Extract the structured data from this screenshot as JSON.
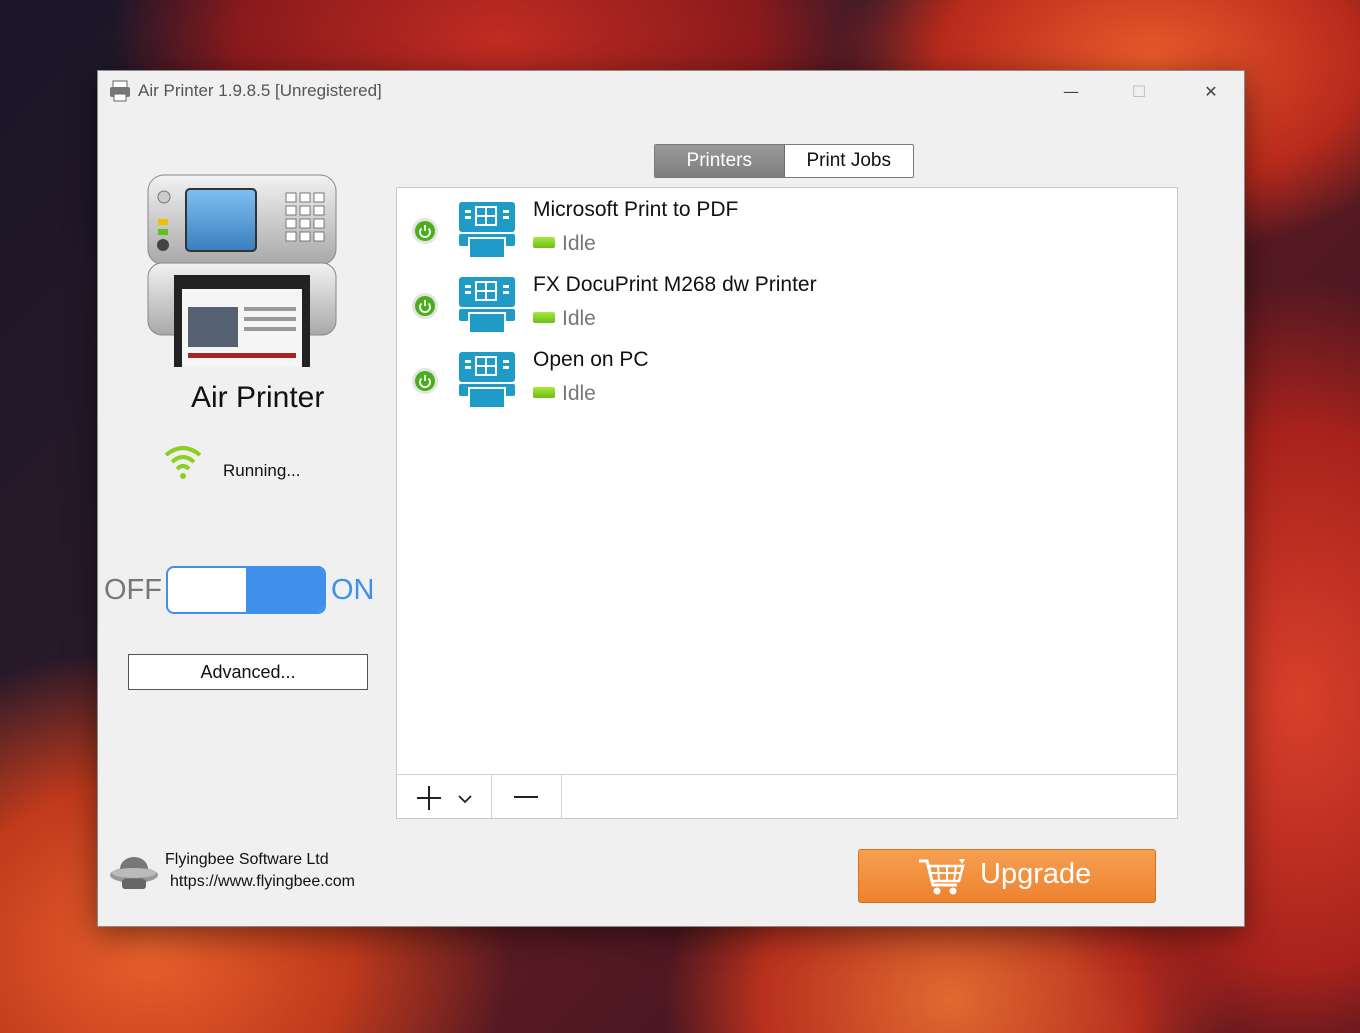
{
  "window": {
    "title": "Air Printer 1.9.8.5 [Unregistered]",
    "minimize_label": "—",
    "maximize_label": "☐",
    "close_label": "✕"
  },
  "sidebar": {
    "app_name": "Air Printer",
    "status": "Running...",
    "toggle": {
      "off_label": "OFF",
      "on_label": "ON",
      "state": "on"
    },
    "advanced_label": "Advanced..."
  },
  "tabs": [
    {
      "label": "Printers",
      "active": true
    },
    {
      "label": "Print Jobs",
      "active": false
    }
  ],
  "printers": [
    {
      "name": "Microsoft Print to PDF",
      "state": "Idle"
    },
    {
      "name": "FX DocuPrint M268 dw Printer",
      "state": "Idle"
    },
    {
      "name": "Open on PC",
      "state": "Idle"
    }
  ],
  "footer": {
    "company": "Flyingbee Software Ltd",
    "url": "https://www.flyingbee.com",
    "upgrade_label": "Upgrade"
  },
  "colors": {
    "accent": "#3f90ea",
    "upgrade": "#ee8230",
    "status_green": "#6cbf14",
    "printer_teal": "#1e9bc6"
  }
}
